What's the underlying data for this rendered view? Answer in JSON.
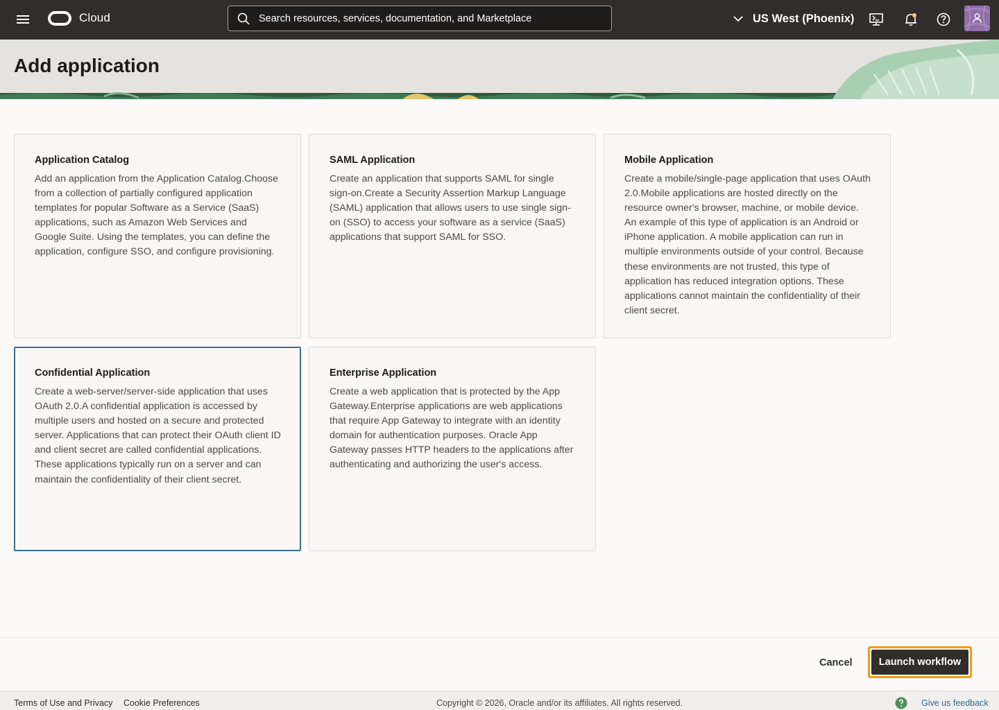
{
  "topbar": {
    "logo_text": "Cloud",
    "search_placeholder": "Search resources, services, documentation, and Marketplace",
    "region": "US West (Phoenix)"
  },
  "page": {
    "title": "Add application"
  },
  "cards": [
    {
      "title": "Application Catalog",
      "description": "Add an application from the Application Catalog.Choose from a collection of partially configured application templates for popular Software as a Service (SaaS) applications, such as Amazon Web Services and Google Suite. Using the templates, you can define the application, configure SSO, and configure provisioning."
    },
    {
      "title": "SAML Application",
      "description": "Create an application that supports SAML for single sign-on.Create a Security Assertion Markup Language (SAML) application that allows users to use single sign-on (SSO) to access your software as a service (SaaS) applications that support SAML for SSO."
    },
    {
      "title": "Mobile Application",
      "description": "Create a mobile/single-page application that uses OAuth 2.0.Mobile applications are hosted directly on the resource owner's browser, machine, or mobile device. An example of this type of application is an Android or iPhone application. A mobile application can run in multiple environments outside of your control. Because these environments are not trusted, this type of application has reduced integration options. These applications cannot maintain the confidentiality of their client secret."
    },
    {
      "title": "Confidential Application",
      "description": "Create a web-server/server-side application that uses OAuth 2.0.A confidential application is accessed by multiple users and hosted on a secure and protected server. Applications that can protect their OAuth client ID and client secret are called confidential applications. These applications typically run on a server and can maintain the confidentiality of their client secret.",
      "selected": true
    },
    {
      "title": "Enterprise Application",
      "description": "Create a web application that is protected by the App Gateway.Enterprise applications are web applications that require App Gateway to integrate with an identity domain for authentication purposes. Oracle App Gateway passes HTTP headers to the applications after authenticating and authorizing the user's access."
    }
  ],
  "actions": {
    "cancel": "Cancel",
    "launch": "Launch workflow"
  },
  "footer": {
    "terms": "Terms of Use and Privacy",
    "cookies": "Cookie Preferences",
    "copyright": "Copyright © 2026, Oracle and/or its affiliates. All rights reserved.",
    "feedback": "Give us feedback"
  },
  "colors": {
    "topbar": "#312d2a",
    "selected_border": "#3b6e8f",
    "highlight": "#f39c12",
    "feedback_link": "#2c6f8f"
  }
}
